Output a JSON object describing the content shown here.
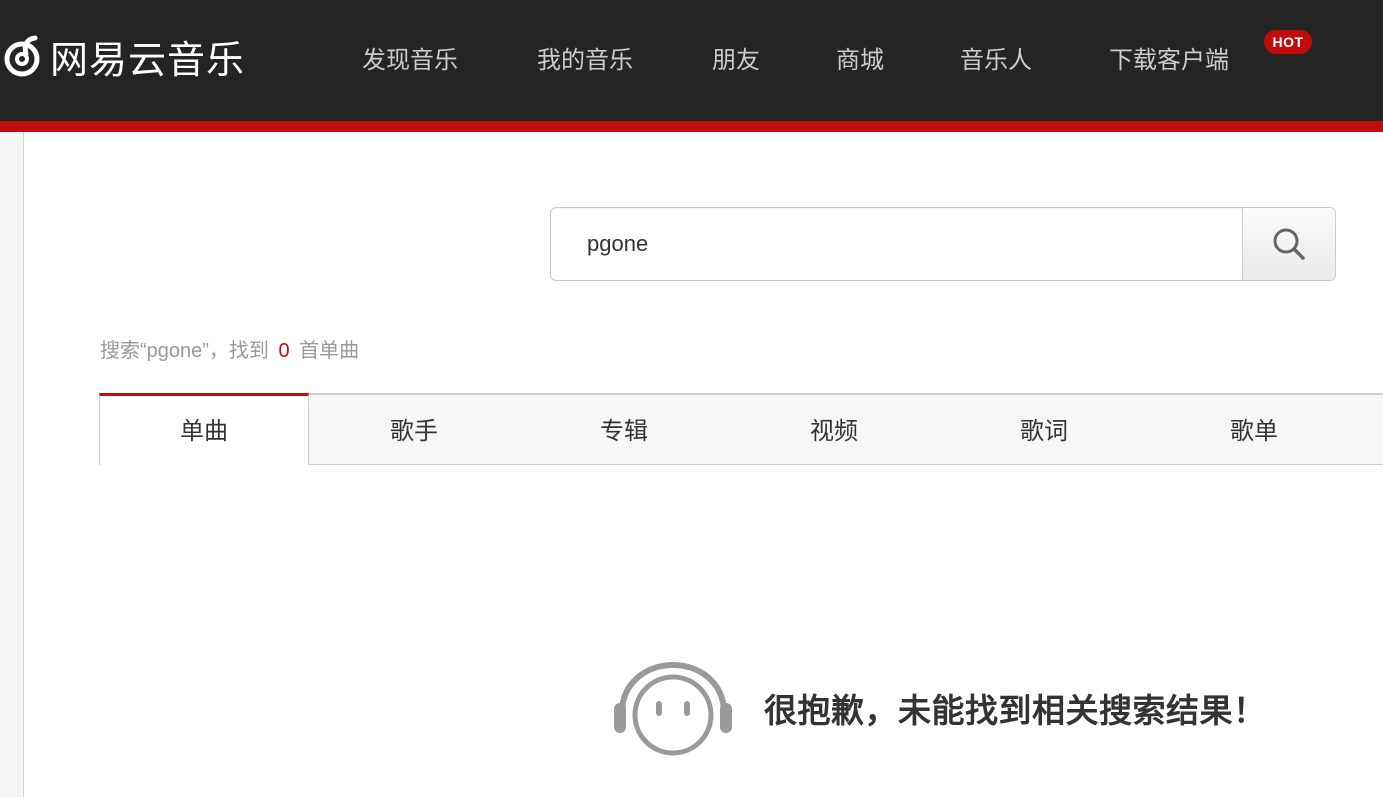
{
  "brand": {
    "name": "网易云音乐"
  },
  "nav": {
    "items": [
      {
        "label": "发现音乐"
      },
      {
        "label": "我的音乐"
      },
      {
        "label": "朋友"
      },
      {
        "label": "商城"
      },
      {
        "label": "音乐人"
      },
      {
        "label": "下载客户端"
      }
    ],
    "hot_badge": "HOT"
  },
  "search": {
    "value": "pgone",
    "icon": "search-icon"
  },
  "summary": {
    "prefix": "搜索“pgone”，找到",
    "count": "0",
    "suffix": "首单曲"
  },
  "tabs": [
    {
      "label": "单曲",
      "active": true
    },
    {
      "label": "歌手"
    },
    {
      "label": "专辑"
    },
    {
      "label": "视频"
    },
    {
      "label": "歌词"
    },
    {
      "label": "歌单"
    }
  ],
  "empty_state": {
    "message": "很抱歉，未能找到相关搜索结果！",
    "icon": "headphones-face-icon"
  },
  "colors": {
    "topbar": "#242424",
    "accent": "#c20c0c",
    "nav_text": "#cccccc"
  }
}
